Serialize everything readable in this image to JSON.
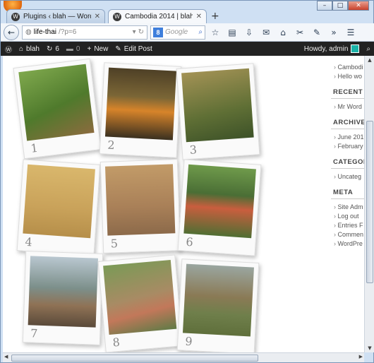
{
  "browser": {
    "tabs": [
      {
        "title": "Plugins ‹ blah — WordPress",
        "active": false
      },
      {
        "title": "Cambodia 2014 | blah",
        "active": true
      }
    ],
    "new_tab": "+",
    "url_host": "life-thai",
    "url_path": "/?p=6",
    "search_engine_badge": "8",
    "search_placeholder": "Google",
    "toolbar_icons": [
      "star-icon",
      "clipboard-icon",
      "download-icon",
      "mail-icon",
      "home-icon",
      "tools-icon",
      "pencil-icon",
      "more-icon",
      "menu-icon"
    ],
    "window_controls": [
      "minimize",
      "maximize",
      "close"
    ]
  },
  "adminbar": {
    "site_name": "blah",
    "updates_count": "6",
    "comments_count": "0",
    "new_label": "New",
    "edit_label": "Edit Post",
    "howdy": "Howdy, admin",
    "accent": "#1ab3a8"
  },
  "gallery": {
    "photos": [
      {
        "number": "1"
      },
      {
        "number": "2"
      },
      {
        "number": "3"
      },
      {
        "number": "4"
      },
      {
        "number": "5"
      },
      {
        "number": "6"
      },
      {
        "number": "7"
      },
      {
        "number": "8"
      },
      {
        "number": "9"
      }
    ]
  },
  "sidebar": {
    "recent_comments_items": [
      "Cambodi",
      "Hello wo"
    ],
    "recent_heading": "RECENT C",
    "recent_items": [
      "Mr Word"
    ],
    "archives_heading": "ARCHIVES",
    "archives_items": [
      "June 201",
      "February"
    ],
    "categories_heading": "CATEGOR",
    "categories_items": [
      "Uncateg"
    ],
    "meta_heading": "META",
    "meta_items": [
      "Site Adm",
      "Log out",
      "Entries F",
      "Commen",
      "WordPre"
    ]
  }
}
